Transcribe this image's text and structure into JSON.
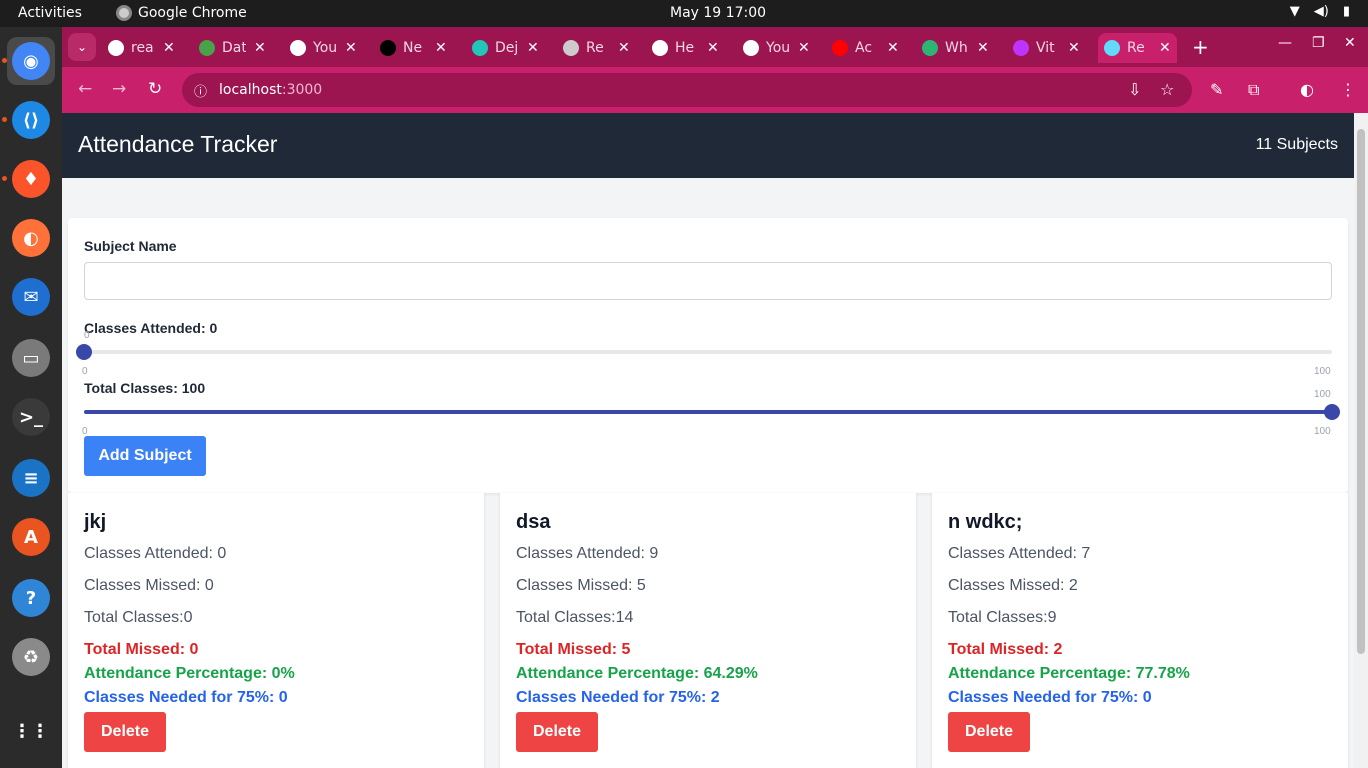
{
  "system": {
    "activities": "Activities",
    "app_name": "Google Chrome",
    "clock": "May 19  17:00"
  },
  "dock": [
    {
      "name": "chrome",
      "color": "#4285f4"
    },
    {
      "name": "vscode",
      "color": "#1e88e5"
    },
    {
      "name": "brave",
      "color": "#fb542b"
    },
    {
      "name": "firefox",
      "color": "#ff7139"
    },
    {
      "name": "thunderbird",
      "color": "#1f6fd0"
    },
    {
      "name": "files",
      "color": "#7a7a7a"
    },
    {
      "name": "terminal",
      "color": "#3a3a3a"
    },
    {
      "name": "writer",
      "color": "#1b73c5"
    },
    {
      "name": "app-center",
      "color": "#e95420"
    },
    {
      "name": "help",
      "color": "#2f86d6"
    },
    {
      "name": "trash",
      "color": "#8a8a8a"
    },
    {
      "name": "show-apps",
      "color": "#2b2b2b"
    }
  ],
  "browser": {
    "tabs": [
      {
        "title": "rea",
        "icon": "github-icon",
        "color": "#ffffff"
      },
      {
        "title": "Dat",
        "icon": "mongodb-icon",
        "color": "#47a248"
      },
      {
        "title": "You",
        "icon": "github-icon",
        "color": "#ffffff"
      },
      {
        "title": "Ne",
        "icon": "nextjs-icon",
        "color": "#000000"
      },
      {
        "title": "Dej",
        "icon": "deploy-icon",
        "color": "#20c6b7"
      },
      {
        "title": "Re",
        "icon": "globe-icon",
        "color": "#cccccc"
      },
      {
        "title": "He",
        "icon": "github-icon",
        "color": "#ffffff"
      },
      {
        "title": "You",
        "icon": "github-icon",
        "color": "#ffffff"
      },
      {
        "title": "Ac",
        "icon": "youtube-icon",
        "color": "#ff0000"
      },
      {
        "title": "Wh",
        "icon": "doc-icon",
        "color": "#2bb673"
      },
      {
        "title": "Vit",
        "icon": "vite-icon",
        "color": "#bd34fe"
      },
      {
        "title": "Re",
        "icon": "react-icon",
        "color": "#61dafb",
        "active": true
      }
    ],
    "url_host": "localhost",
    "url_port": ":3000"
  },
  "app": {
    "title": "Attendance Tracker",
    "subject_count": "11 Subjects",
    "form": {
      "subject_label": "Subject Name",
      "subject_value": "",
      "attended_label": "Classes Attended: 0",
      "attended_value": 0,
      "attended_min": "0",
      "attended_max": "100",
      "attended_current": "0",
      "total_label": "Total Classes: 100",
      "total_value": 100,
      "total_min": "0",
      "total_max": "100",
      "total_current": "100",
      "add_button": "Add Subject"
    },
    "subjects": [
      {
        "name": "jkj",
        "attended": "Classes Attended: 0",
        "missed": "Classes Missed: 0",
        "total": "Total Classes:0",
        "total_missed": "Total Missed: 0",
        "percentage": "Attendance Percentage: 0%",
        "needed": "Classes Needed for 75%: 0",
        "delete": "Delete"
      },
      {
        "name": "dsa",
        "attended": "Classes Attended: 9",
        "missed": "Classes Missed: 5",
        "total": "Total Classes:14",
        "total_missed": "Total Missed: 5",
        "percentage": "Attendance Percentage: 64.29%",
        "needed": "Classes Needed for 75%: 2",
        "delete": "Delete"
      },
      {
        "name": "n wdkc;",
        "attended": "Classes Attended: 7",
        "missed": "Classes Missed: 2",
        "total": "Total Classes:9",
        "total_missed": "Total Missed: 2",
        "percentage": "Attendance Percentage: 77.78%",
        "needed": "Classes Needed for 75%: 0",
        "delete": "Delete"
      }
    ]
  }
}
